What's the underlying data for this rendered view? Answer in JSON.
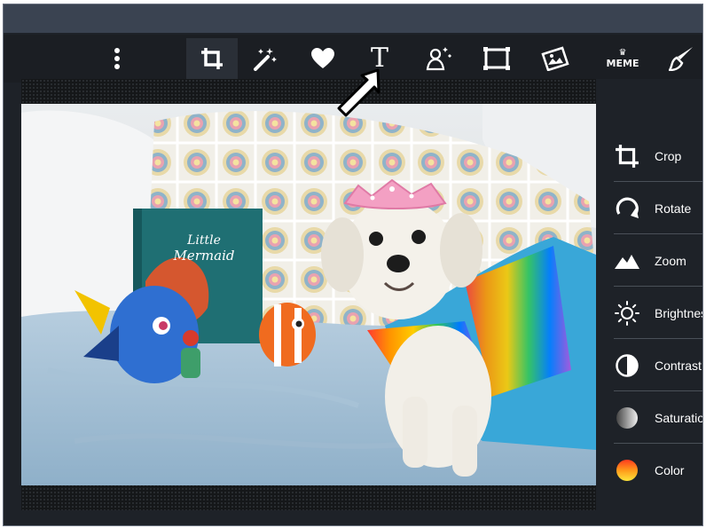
{
  "toolbar": {
    "tools": [
      {
        "id": "more",
        "icon": "more-vertical-icon"
      },
      {
        "id": "crop",
        "icon": "crop-icon",
        "active": true
      },
      {
        "id": "auto-enhance",
        "icon": "magic-wand-icon"
      },
      {
        "id": "favorites",
        "icon": "heart-icon"
      },
      {
        "id": "text",
        "icon": "text-icon",
        "glyph": "T"
      },
      {
        "id": "effects",
        "icon": "figure-sparkle-icon"
      },
      {
        "id": "frames",
        "icon": "frame-icon"
      },
      {
        "id": "stickers",
        "icon": "sticker-icon"
      },
      {
        "id": "meme",
        "icon": "meme-icon",
        "glyph": "MEME"
      },
      {
        "id": "paint",
        "icon": "paintbrush-icon"
      }
    ]
  },
  "side_panel": {
    "items": [
      {
        "label": "Crop",
        "icon": "crop-icon"
      },
      {
        "label": "Rotate",
        "icon": "rotate-icon"
      },
      {
        "label": "Zoom",
        "icon": "zoom-mountain-icon"
      },
      {
        "label": "Brightness",
        "icon": "sun-icon"
      },
      {
        "label": "Contrast",
        "icon": "contrast-icon"
      },
      {
        "label": "Saturation",
        "icon": "saturation-icon"
      },
      {
        "label": "Color",
        "icon": "color-gradient-icon"
      }
    ]
  },
  "canvas": {
    "photo_alt": "Small white dog wearing a pink tiara and rainbow dress on a blue blanket beside a Little Mermaid book and plush fish toys"
  },
  "book": {
    "title_line1": "Little",
    "title_line2": "Mermaid"
  },
  "colors": {
    "frame_bg": "#1e2228",
    "titlebar": "#3a4351",
    "toolbar": "#1b1e23",
    "active_tool": "#2a2f37",
    "text": "#ffffff"
  }
}
